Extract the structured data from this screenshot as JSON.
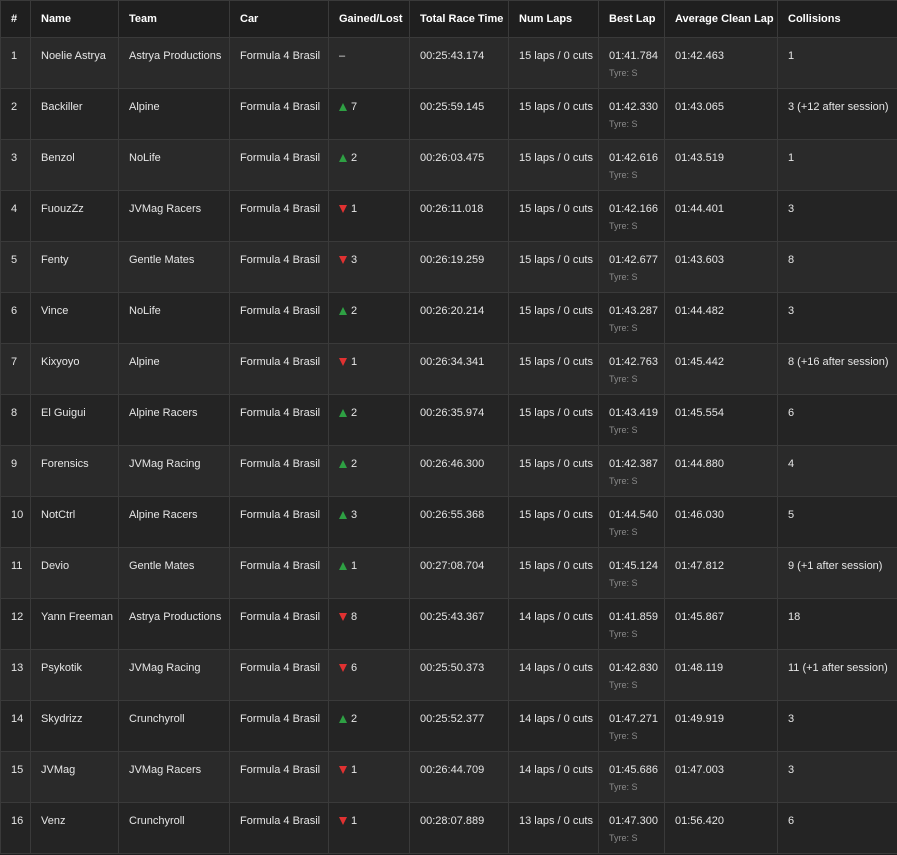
{
  "colors": {
    "gain": "#2ea043",
    "loss": "#e03131",
    "header_text": "#ffffff",
    "muted_text": "#8a8a8a"
  },
  "columns": [
    "#",
    "Name",
    "Team",
    "Car",
    "Gained/Lost",
    "Total Race Time",
    "Num Laps",
    "Best Lap",
    "Average Clean Lap",
    "Collisions"
  ],
  "rows": [
    {
      "pos": "1",
      "name": "Noelie Astrya",
      "team": "Astrya Productions",
      "car": "Formula 4 Brasil",
      "dir": "none",
      "delta": "–",
      "total": "00:25:43.174",
      "laps": "15 laps / 0 cuts",
      "best": "01:41.784",
      "tyre": "Tyre: S",
      "avg": "01:42.463",
      "collisions": "1"
    },
    {
      "pos": "2",
      "name": "Backiller",
      "team": "Alpine",
      "car": "Formula 4 Brasil",
      "dir": "up",
      "delta": "7",
      "total": "00:25:59.145",
      "laps": "15 laps / 0 cuts",
      "best": "01:42.330",
      "tyre": "Tyre: S",
      "avg": "01:43.065",
      "collisions": "3 (+12 after session)"
    },
    {
      "pos": "3",
      "name": "Benzol",
      "team": "NoLife",
      "car": "Formula 4 Brasil",
      "dir": "up",
      "delta": "2",
      "total": "00:26:03.475",
      "laps": "15 laps / 0 cuts",
      "best": "01:42.616",
      "tyre": "Tyre: S",
      "avg": "01:43.519",
      "collisions": "1"
    },
    {
      "pos": "4",
      "name": "FuouzZz",
      "team": "JVMag Racers",
      "car": "Formula 4 Brasil",
      "dir": "down",
      "delta": "1",
      "total": "00:26:11.018",
      "laps": "15 laps / 0 cuts",
      "best": "01:42.166",
      "tyre": "Tyre: S",
      "avg": "01:44.401",
      "collisions": "3"
    },
    {
      "pos": "5",
      "name": "Fenty",
      "team": "Gentle Mates",
      "car": "Formula 4 Brasil",
      "dir": "down",
      "delta": "3",
      "total": "00:26:19.259",
      "laps": "15 laps / 0 cuts",
      "best": "01:42.677",
      "tyre": "Tyre: S",
      "avg": "01:43.603",
      "collisions": "8"
    },
    {
      "pos": "6",
      "name": "Vince",
      "team": "NoLife",
      "car": "Formula 4 Brasil",
      "dir": "up",
      "delta": "2",
      "total": "00:26:20.214",
      "laps": "15 laps / 0 cuts",
      "best": "01:43.287",
      "tyre": "Tyre: S",
      "avg": "01:44.482",
      "collisions": "3"
    },
    {
      "pos": "7",
      "name": "Kixyoyo",
      "team": "Alpine",
      "car": "Formula 4 Brasil",
      "dir": "down",
      "delta": "1",
      "total": "00:26:34.341",
      "laps": "15 laps / 0 cuts",
      "best": "01:42.763",
      "tyre": "Tyre: S",
      "avg": "01:45.442",
      "collisions": "8 (+16 after session)"
    },
    {
      "pos": "8",
      "name": "El Guigui",
      "team": "Alpine Racers",
      "car": "Formula 4 Brasil",
      "dir": "up",
      "delta": "2",
      "total": "00:26:35.974",
      "laps": "15 laps / 0 cuts",
      "best": "01:43.419",
      "tyre": "Tyre: S",
      "avg": "01:45.554",
      "collisions": "6"
    },
    {
      "pos": "9",
      "name": "Forensics",
      "team": "JVMag Racing",
      "car": "Formula 4 Brasil",
      "dir": "up",
      "delta": "2",
      "total": "00:26:46.300",
      "laps": "15 laps / 0 cuts",
      "best": "01:42.387",
      "tyre": "Tyre: S",
      "avg": "01:44.880",
      "collisions": "4"
    },
    {
      "pos": "10",
      "name": "NotCtrl",
      "team": "Alpine Racers",
      "car": "Formula 4 Brasil",
      "dir": "up",
      "delta": "3",
      "total": "00:26:55.368",
      "laps": "15 laps / 0 cuts",
      "best": "01:44.540",
      "tyre": "Tyre: S",
      "avg": "01:46.030",
      "collisions": "5"
    },
    {
      "pos": "11",
      "name": "Devio",
      "team": "Gentle Mates",
      "car": "Formula 4 Brasil",
      "dir": "up",
      "delta": "1",
      "total": "00:27:08.704",
      "laps": "15 laps / 0 cuts",
      "best": "01:45.124",
      "tyre": "Tyre: S",
      "avg": "01:47.812",
      "collisions": "9 (+1 after session)"
    },
    {
      "pos": "12",
      "name": "Yann Freeman",
      "team": "Astrya Productions",
      "car": "Formula 4 Brasil",
      "dir": "down",
      "delta": "8",
      "total": "00:25:43.367",
      "laps": "14 laps / 0 cuts",
      "best": "01:41.859",
      "tyre": "Tyre: S",
      "avg": "01:45.867",
      "collisions": "18"
    },
    {
      "pos": "13",
      "name": "Psykotik",
      "team": "JVMag Racing",
      "car": "Formula 4 Brasil",
      "dir": "down",
      "delta": "6",
      "total": "00:25:50.373",
      "laps": "14 laps / 0 cuts",
      "best": "01:42.830",
      "tyre": "Tyre: S",
      "avg": "01:48.119",
      "collisions": "11 (+1 after session)"
    },
    {
      "pos": "14",
      "name": "Skydrizz",
      "team": "Crunchyroll",
      "car": "Formula 4 Brasil",
      "dir": "up",
      "delta": "2",
      "total": "00:25:52.377",
      "laps": "14 laps / 0 cuts",
      "best": "01:47.271",
      "tyre": "Tyre: S",
      "avg": "01:49.919",
      "collisions": "3"
    },
    {
      "pos": "15",
      "name": "JVMag",
      "team": "JVMag Racers",
      "car": "Formula 4 Brasil",
      "dir": "down",
      "delta": "1",
      "total": "00:26:44.709",
      "laps": "14 laps / 0 cuts",
      "best": "01:45.686",
      "tyre": "Tyre: S",
      "avg": "01:47.003",
      "collisions": "3"
    },
    {
      "pos": "16",
      "name": "Venz",
      "team": "Crunchyroll",
      "car": "Formula 4 Brasil",
      "dir": "down",
      "delta": "1",
      "total": "00:28:07.889",
      "laps": "13 laps / 0 cuts",
      "best": "01:47.300",
      "tyre": "Tyre: S",
      "avg": "01:56.420",
      "collisions": "6"
    }
  ]
}
